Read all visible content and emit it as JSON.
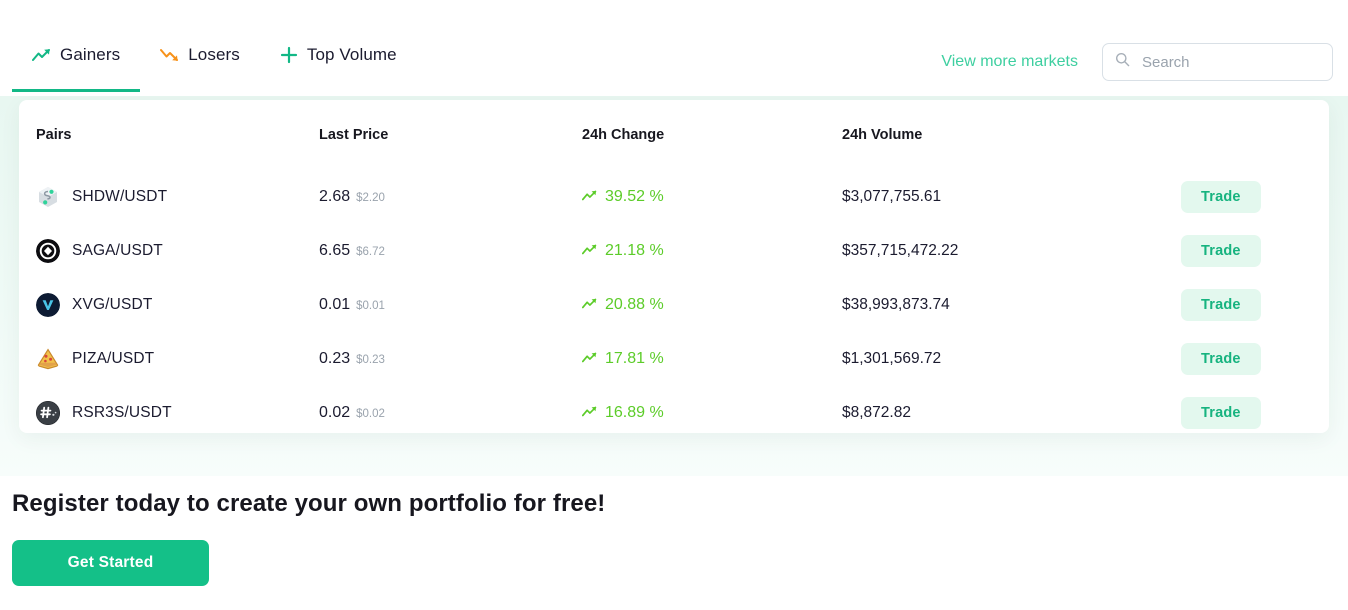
{
  "tabs": [
    {
      "label": "Gainers",
      "icon": "trending-up-icon",
      "active": true
    },
    {
      "label": "Losers",
      "icon": "trending-down-icon",
      "active": false
    },
    {
      "label": "Top Volume",
      "icon": "plus-icon",
      "active": false
    }
  ],
  "header": {
    "view_more_label": "View more markets",
    "search_placeholder": "Search",
    "search_value": "",
    "search_icon": "search-icon"
  },
  "table": {
    "columns": [
      "Pairs",
      "Last Price",
      "24h Change",
      "24h Volume"
    ],
    "trade_label": "Trade",
    "rows": [
      {
        "pair": "SHDW/USDT",
        "icon": "shdw-coin-icon",
        "price": "2.68",
        "price_usd": "$2.20",
        "change": "39.52 %",
        "change_icon": "trending-up-icon",
        "volume": "$3,077,755.61"
      },
      {
        "pair": "SAGA/USDT",
        "icon": "saga-coin-icon",
        "price": "6.65",
        "price_usd": "$6.72",
        "change": "21.18 %",
        "change_icon": "trending-up-icon",
        "volume": "$357,715,472.22"
      },
      {
        "pair": "XVG/USDT",
        "icon": "xvg-coin-icon",
        "price": "0.01",
        "price_usd": "$0.01",
        "change": "20.88 %",
        "change_icon": "trending-up-icon",
        "volume": "$38,993,873.74"
      },
      {
        "pair": "PIZA/USDT",
        "icon": "piza-coin-icon",
        "price": "0.23",
        "price_usd": "$0.23",
        "change": "17.81 %",
        "change_icon": "trending-up-icon",
        "volume": "$1,301,569.72"
      },
      {
        "pair": "RSR3S/USDT",
        "icon": "rsr3s-coin-icon",
        "price": "0.02",
        "price_usd": "$0.02",
        "change": "16.89 %",
        "change_icon": "trending-up-icon",
        "volume": "$8,872.82"
      }
    ]
  },
  "cta": {
    "title": "Register today to create your own portfolio for free!",
    "button_label": "Get Started"
  },
  "colors": {
    "accent_green": "#14c088",
    "link_green": "#3ecfa0",
    "change_green": "#5ccc29",
    "losers_orange": "#f7921a",
    "trade_bg": "#e3f8ee",
    "trade_text": "#16b37f"
  }
}
